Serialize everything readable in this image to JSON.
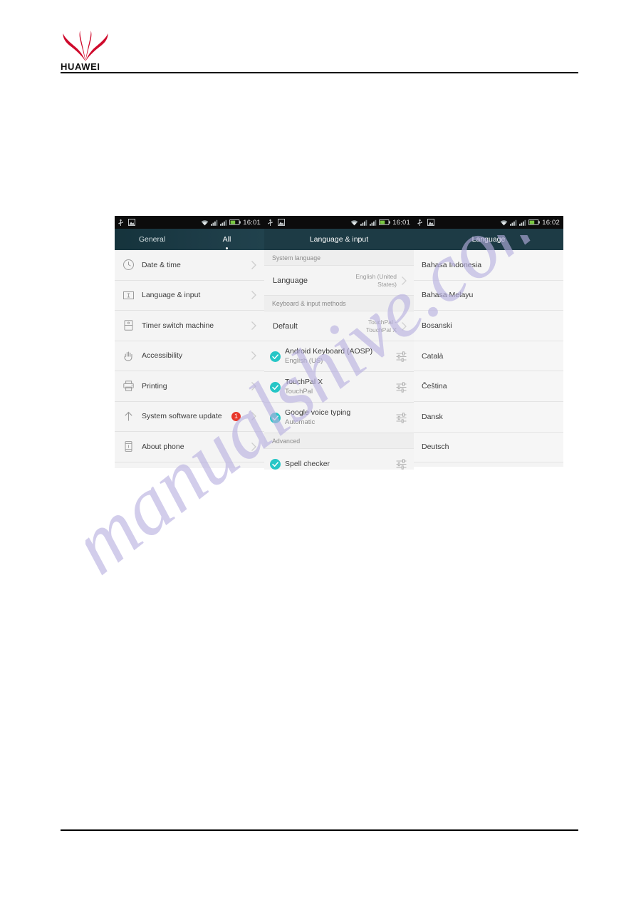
{
  "document": {
    "logo_wordmark": "HUAWEI",
    "watermark_text": "manualshive.com"
  },
  "colors": {
    "header_bar": "#1d3b45",
    "accent_check": "#26c6c6",
    "badge_red": "#e8372a",
    "brand_red": "#cf0a2c",
    "list_bg": "#f4f4f4",
    "section_bg": "#eeeeee"
  },
  "screens": [
    {
      "id": "settings-all",
      "statusbar": {
        "time": "16:01",
        "left_icons": [
          "usb-icon",
          "screenshot-icon"
        ],
        "right_icons": [
          "wifi-icon",
          "signal-1-icon",
          "signal-2-icon",
          "battery-icon"
        ]
      },
      "tabs": [
        {
          "label": "General",
          "active": false
        },
        {
          "label": "All",
          "active": true
        }
      ],
      "items": [
        {
          "label": "Date & time",
          "icon": "clock-icon",
          "badge": ""
        },
        {
          "label": "Language & input",
          "icon": "keyboard-input-icon",
          "badge": ""
        },
        {
          "label": "Timer switch machine",
          "icon": "timer-switch-icon",
          "badge": ""
        },
        {
          "label": "Accessibility",
          "icon": "hand-icon",
          "badge": ""
        },
        {
          "label": "Printing",
          "icon": "printer-icon",
          "badge": ""
        },
        {
          "label": "System software update",
          "icon": "up-arrow-icon",
          "badge": "1"
        },
        {
          "label": "About phone",
          "icon": "phone-info-icon",
          "badge": ""
        }
      ]
    },
    {
      "id": "language-and-input",
      "statusbar": {
        "time": "16:01",
        "left_icons": [
          "usb-icon",
          "screenshot-icon"
        ],
        "right_icons": [
          "wifi-icon",
          "signal-1-icon",
          "signal-2-icon",
          "battery-icon"
        ]
      },
      "title": "Language & input",
      "sections": [
        {
          "type": "header",
          "label": "System language"
        },
        {
          "type": "value-row",
          "label": "Language",
          "value": "English (United States)"
        },
        {
          "type": "header",
          "label": "Keyboard & input methods"
        },
        {
          "type": "value-row",
          "label": "Default",
          "value": "TouchPal - TouchPal X"
        },
        {
          "type": "ime-row",
          "title": "Android Keyboard (AOSP)",
          "subtitle": "English (US)",
          "checked": true
        },
        {
          "type": "ime-row",
          "title": "TouchPal X",
          "subtitle": "TouchPal",
          "checked": true
        },
        {
          "type": "ime-row",
          "title": "Google voice typing",
          "subtitle": "Automatic",
          "checked": true
        },
        {
          "type": "header",
          "label": "Advanced"
        },
        {
          "type": "ime-row",
          "title": "Spell checker",
          "subtitle": "",
          "checked": true
        }
      ]
    },
    {
      "id": "language-list",
      "statusbar": {
        "time": "16:02",
        "left_icons": [
          "usb-icon",
          "screenshot-icon"
        ],
        "right_icons": [
          "wifi-icon",
          "signal-1-icon",
          "signal-2-icon",
          "battery-icon"
        ]
      },
      "title": "Language",
      "languages": [
        "Bahasa Indonesia",
        "Bahasa Melayu",
        "Bosanski",
        "Català",
        "Čeština",
        "Dansk",
        "Deutsch"
      ]
    }
  ]
}
